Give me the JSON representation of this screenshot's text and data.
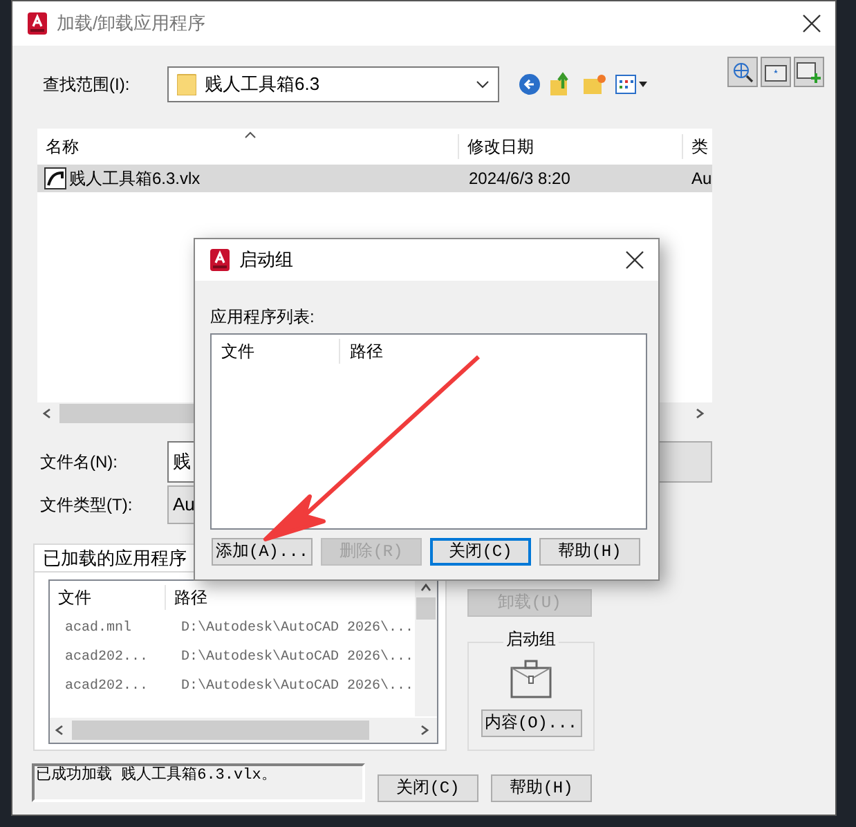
{
  "window": {
    "title": "加载/卸载应用程序"
  },
  "look_in": {
    "label": "查找范围(I):",
    "value": "贱人工具箱6.3"
  },
  "file_list": {
    "columns": [
      "名称",
      "修改日期",
      "类"
    ],
    "rows": [
      {
        "name": "贱人工具箱6.3.vlx",
        "modified": "2024/6/3 8:20",
        "column_3": "Au",
        "selected": true
      }
    ]
  },
  "file_name": {
    "label": "文件名(N):",
    "value": "贱"
  },
  "file_type": {
    "label": "文件类型(T):",
    "value": "Au"
  },
  "tabs": [
    {
      "label": "已加载的应用程序",
      "selected": true
    }
  ],
  "loaded_apps": {
    "columns": [
      "文件",
      "路径"
    ],
    "rows": [
      {
        "file": "acad.mnl",
        "path": "D:\\Autodesk\\AutoCAD 2026\\..."
      },
      {
        "file": "acad202...",
        "path": "D:\\Autodesk\\AutoCAD 2026\\..."
      },
      {
        "file": "acad202...",
        "path": "D:\\Autodesk\\AutoCAD 2026\\..."
      }
    ]
  },
  "unload_button": {
    "label": "卸载(U)",
    "disabled": true
  },
  "startup_suite": {
    "title": "启动组",
    "button": "内容(O)..."
  },
  "status": "已成功加载 贱人工具箱6.3.vlx。",
  "buttons": [
    "关闭(C)",
    "帮助(H)"
  ],
  "dialog": {
    "title": "启动组",
    "list_label": "应用程序列表:",
    "columns": [
      "文件",
      "路径"
    ],
    "buttons": [
      {
        "label": "添加(A)...",
        "disabled": false,
        "focused": false
      },
      {
        "label": "删除(R)",
        "disabled": true,
        "focused": false
      },
      {
        "label": "关闭(C)",
        "disabled": false,
        "focused": true
      },
      {
        "label": "帮助(H)",
        "disabled": false,
        "focused": false
      }
    ]
  }
}
